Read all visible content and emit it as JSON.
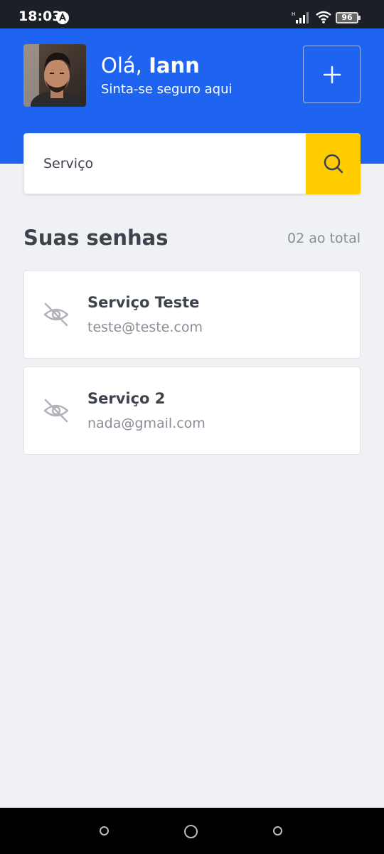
{
  "status_bar": {
    "time": "18:03",
    "network_label": "H",
    "battery": "96"
  },
  "header": {
    "greeting_prefix": "Olá,",
    "user_name": "Iann",
    "subtitle": "Sinta-se seguro aqui",
    "add_icon": "plus-icon",
    "background_color": "#1E64F0"
  },
  "search": {
    "value": "",
    "placeholder": "Serviço",
    "icon": "search-icon",
    "button_color": "#FFCC00"
  },
  "passwords_section": {
    "title": "Suas senhas",
    "count_text": "02 ao total"
  },
  "password_cards": [
    {
      "service": "Serviço Teste",
      "email": "teste@teste.com",
      "icon": "eye-off-icon"
    },
    {
      "service": "Serviço 2",
      "email": "nada@gmail.com",
      "icon": "eye-off-icon"
    }
  ],
  "nav_bar": {
    "buttons": [
      "recent-apps",
      "home",
      "back"
    ]
  }
}
